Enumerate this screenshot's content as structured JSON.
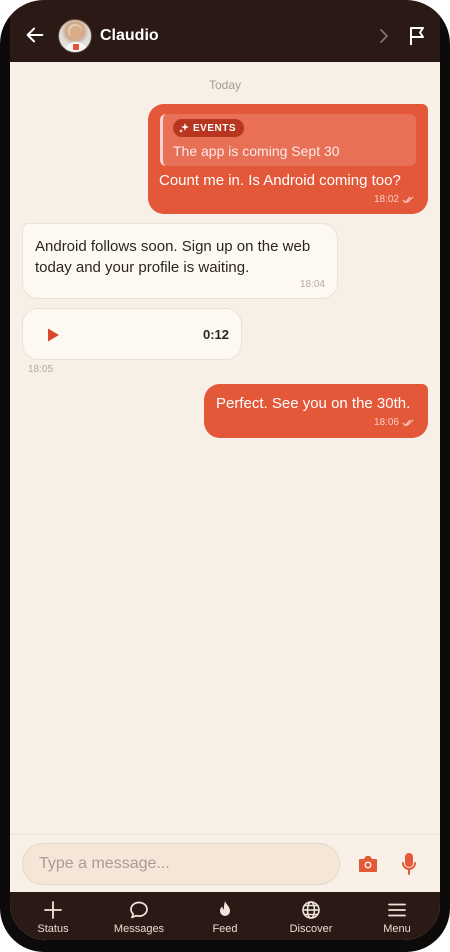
{
  "header": {
    "contact_name": "Claudio"
  },
  "chat": {
    "date_label": "Today",
    "messages": [
      {
        "quote_tag": "EVENTS",
        "quote_text": "The app is coming Sept 30",
        "text": "Count me in. Is Android coming too?",
        "time": "18:02"
      },
      {
        "text": "Android follows soon. Sign up on the web today and your profile is waiting.",
        "time": "18:04"
      },
      {
        "voice_duration": "0:12",
        "time": "18:05"
      },
      {
        "text": "Perfect. See you on the 30th.",
        "time": "18:06"
      }
    ]
  },
  "composer": {
    "placeholder": "Type a message..."
  },
  "nav": {
    "items": [
      {
        "label": "Status",
        "icon": "plus-icon"
      },
      {
        "label": "Messages",
        "icon": "chat-bubble-icon"
      },
      {
        "label": "Feed",
        "icon": "flame-icon"
      },
      {
        "label": "Discover",
        "icon": "globe-icon"
      },
      {
        "label": "Menu",
        "icon": "hamburger-icon"
      }
    ]
  },
  "colors": {
    "accent": "#e4583a",
    "header_bg": "#2a1915",
    "chat_bg": "#f8f0e7"
  }
}
